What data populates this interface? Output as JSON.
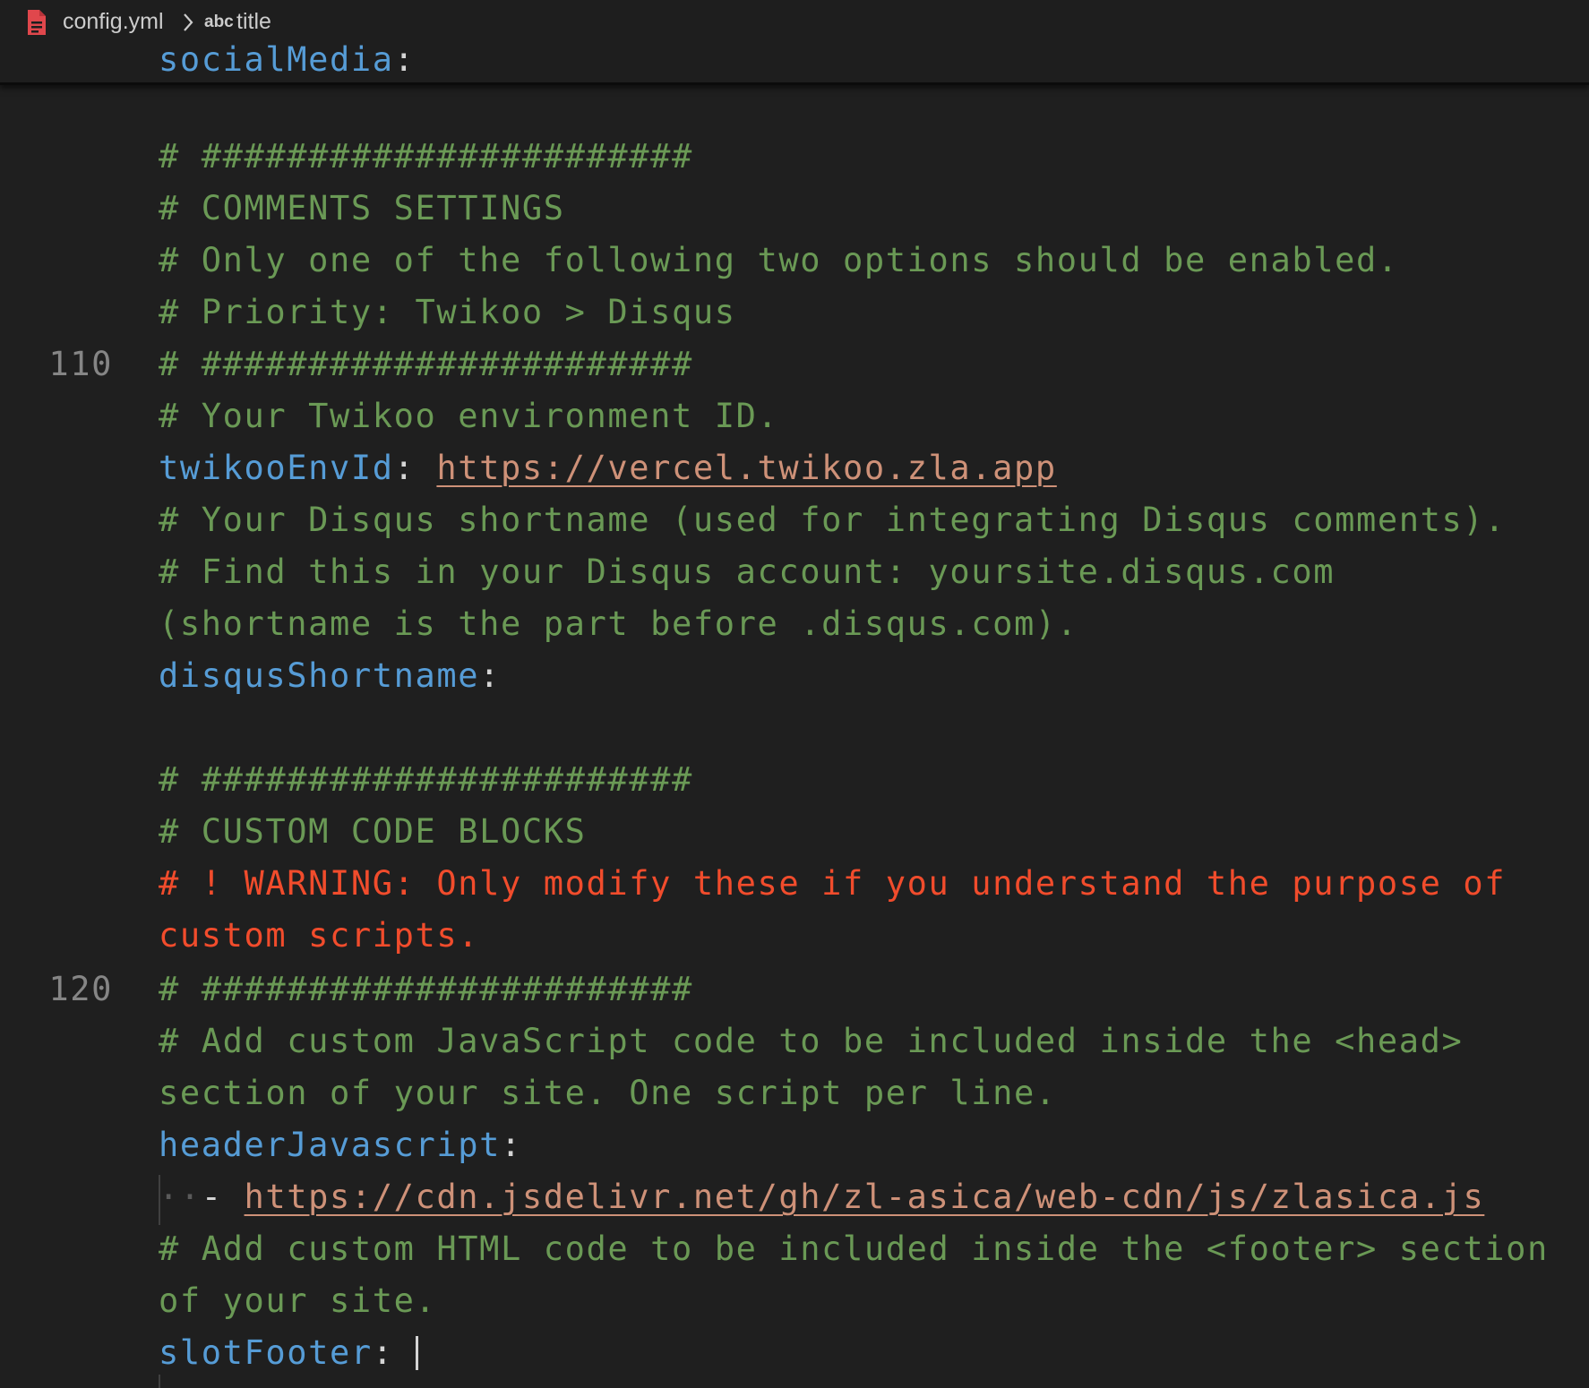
{
  "breadcrumb": {
    "file": "config.yml",
    "symbol_badge": "abc",
    "symbol": "title"
  },
  "sticky": {
    "key": "socialMedia",
    "colon": ":"
  },
  "line_numbers": {
    "n110": "110",
    "n120": "120"
  },
  "code": {
    "l01": "# #######################",
    "l02": "# COMMENTS SETTINGS",
    "l03": "# Only one of the following two options should be enabled.",
    "l04": "# Priority: Twikoo > Disqus",
    "l05": "# #######################",
    "l06": "# Your Twikoo environment ID.",
    "l07_key": "twikooEnvId",
    "l07_colon": ": ",
    "l07_url": "https://vercel.twikoo.zla.app",
    "l08": "# Your Disqus shortname (used for integrating Disqus comments).",
    "l09": "# Find this in your Disqus account: yoursite.disqus.com",
    "l10": "(shortname is the part before .disqus.com).",
    "l11_key": "disqusShortname",
    "l11_colon": ":",
    "l13": "# #######################",
    "l14": "# CUSTOM CODE BLOCKS",
    "l15": "# ! WARNING: Only modify these if you understand the purpose of",
    "l16": "custom scripts.",
    "l17": "# #######################",
    "l18": "# Add custom JavaScript code to be included inside the <head>",
    "l19": "section of your site. One script per line.",
    "l20_key": "headerJavascript",
    "l20_colon": ":",
    "l21_ws": "··",
    "l21_dash": "- ",
    "l21_url": "https://cdn.jsdelivr.net/gh/zl-asica/web-cdn/js/zlasica.js",
    "l22": "# Add custom HTML code to be included inside the <footer> section",
    "l23": "of your site.",
    "l24_key": "slotFooter",
    "l24_colon": ": "
  },
  "colors": {
    "background": "#1f1f1f",
    "comment": "#6a9955",
    "key": "#569cd6",
    "warning": "#f14c2c",
    "string_url": "#ce9178",
    "line_number": "#858585",
    "file_icon": "#e0474c"
  }
}
